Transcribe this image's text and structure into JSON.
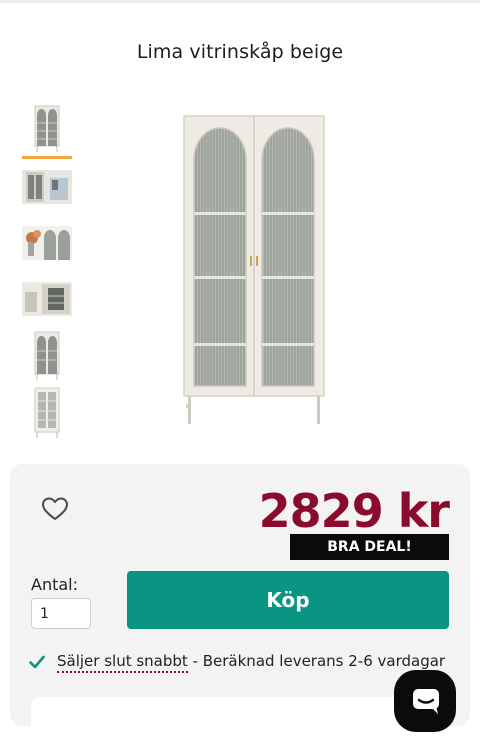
{
  "product": {
    "title": "Lima vitrinskåp beige",
    "price": "2829 kr",
    "deal_badge": "BRA DEAL!"
  },
  "gallery": {
    "thumbnails": [
      {
        "name": "thumb-cabinet-front",
        "selected": true
      },
      {
        "name": "thumb-cabinet-room"
      },
      {
        "name": "thumb-cabinet-flowers"
      },
      {
        "name": "thumb-cabinet-shelves"
      },
      {
        "name": "thumb-cabinet-side"
      },
      {
        "name": "thumb-cabinet-open"
      }
    ]
  },
  "purchase": {
    "quantity_label": "Antal:",
    "quantity_value": "1",
    "buy_label": "Köp"
  },
  "stock": {
    "fast_text": "Säljer slut snabbt",
    "delivery_text": " - Beräknad leverans 2-6 vardagar"
  },
  "icons": {
    "wishlist": "heart-outline-icon",
    "stock": "checkmark-icon",
    "chat": "chat-bubble-icon"
  },
  "colors": {
    "price": "#8a0b2c",
    "buy_button": "#0a9582",
    "deal_badge": "#0b0b0b",
    "thumb_selected": "#f2a838",
    "check": "#0a9582"
  }
}
